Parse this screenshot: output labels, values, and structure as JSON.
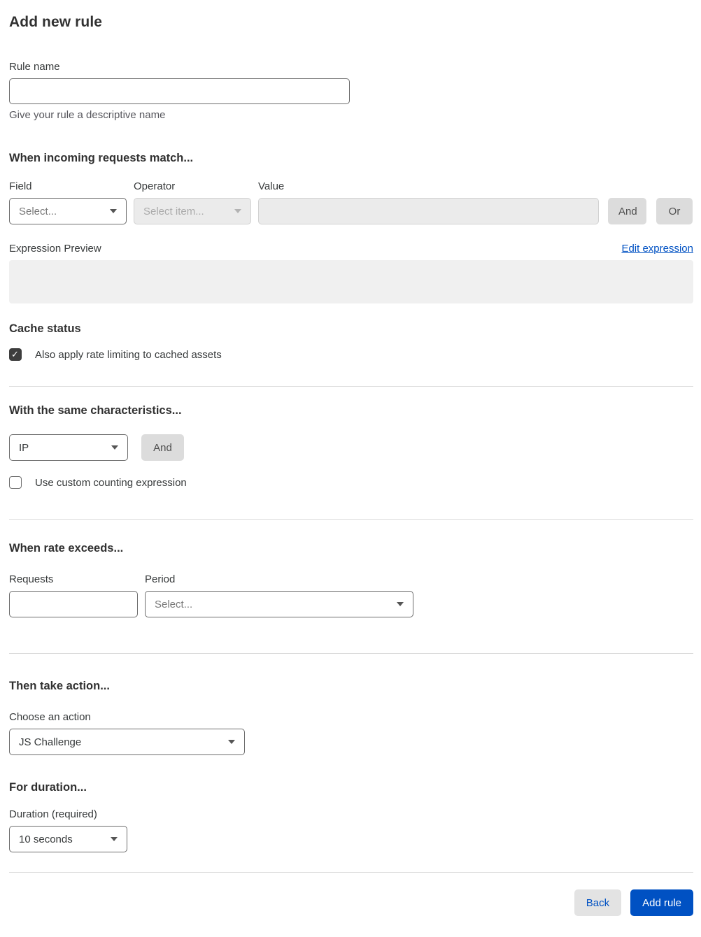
{
  "page": {
    "title": "Add new rule"
  },
  "rule_name": {
    "label": "Rule name",
    "value": "",
    "helper": "Give your rule a descriptive name"
  },
  "match_section": {
    "heading": "When incoming requests match...",
    "field": {
      "label": "Field",
      "selected": "Select..."
    },
    "operator": {
      "label": "Operator",
      "selected": "Select item...",
      "disabled": true
    },
    "value": {
      "label": "Value",
      "value": "",
      "disabled": true
    },
    "and_button": "And",
    "or_button": "Or",
    "expression_preview": {
      "label": "Expression Preview",
      "edit_link": "Edit expression",
      "content": ""
    },
    "cache_status": {
      "heading": "Cache status",
      "checkbox_label": "Also apply rate limiting to cached assets",
      "checked": true
    }
  },
  "characteristics_section": {
    "heading": "With the same characteristics...",
    "characteristic": {
      "selected": "IP"
    },
    "and_button": "And",
    "custom_counting": {
      "checkbox_label": "Use custom counting expression",
      "checked": false
    }
  },
  "rate_section": {
    "heading": "When rate exceeds...",
    "requests": {
      "label": "Requests",
      "value": ""
    },
    "period": {
      "label": "Period",
      "selected": "Select..."
    }
  },
  "action_section": {
    "heading": "Then take action...",
    "action": {
      "label": "Choose an action",
      "selected": "JS Challenge"
    }
  },
  "duration_section": {
    "heading": "For duration...",
    "duration": {
      "label": "Duration (required)",
      "selected": "10 seconds"
    }
  },
  "footer": {
    "back_button": "Back",
    "submit_button": "Add rule"
  },
  "colors": {
    "accent_blue": "#0051c3",
    "checkbox_checked": "#3d3d3d",
    "disabled_bg": "#ebebeb",
    "divider": "#d9d9d9",
    "preview_bg": "#f0f0f0"
  }
}
